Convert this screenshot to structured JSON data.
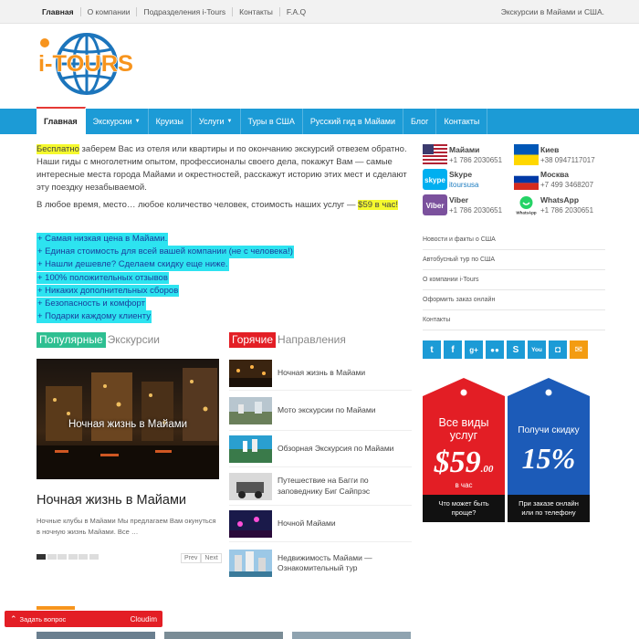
{
  "topbar": {
    "nav": [
      "Главная",
      "О компании",
      "Подразделения i-Tours",
      "Контакты",
      "F.A.Q"
    ],
    "tagline": "Экскурсии в Майами и США."
  },
  "logo": {
    "text": "i-TOURS",
    "brand_orange": "#f7941d",
    "brand_blue": "#1c75bc"
  },
  "mainnav": {
    "items": [
      {
        "label": "Главная",
        "active": true,
        "caret": false
      },
      {
        "label": "Экскурсии",
        "active": false,
        "caret": true
      },
      {
        "label": "Круизы",
        "active": false,
        "caret": false
      },
      {
        "label": "Услуги",
        "active": false,
        "caret": true
      },
      {
        "label": "Туры в США",
        "active": false,
        "caret": false
      },
      {
        "label": "Русский гид в Майами",
        "active": false,
        "caret": false
      },
      {
        "label": "Блог",
        "active": false,
        "caret": false
      },
      {
        "label": "Контакты",
        "active": false,
        "caret": false
      }
    ],
    "color": "#1c9bd6"
  },
  "intro": {
    "free": "Бесплатно",
    "p1": " заберем Вас из отеля или квартиры и по окончанию экскурсий отвезем обратно.",
    "p2": "Наши гиды с многолетним опытом, профессионалы своего дела, покажут Вам — самые интересные места города Майами и окрестностей, расскажут историю этих мест и сделают эту поездку незабываемой.",
    "p3": "В любое время, место… любое количество человек, стоимость наших услуг — ",
    "price": "$59 в час!"
  },
  "benefits": [
    "+ Самая низкая цена в Майами.",
    "+ Единая стоимость для всей вашей компании (не с человека!)",
    "+ Нашли дешевле? Сделаем скидку еще ниже.",
    "+ 100% положительных отзывов",
    "+ Никаких дополнительных сборов",
    "+ Безопасность и комфорт",
    "+ Подарки каждому клиенту"
  ],
  "popular": {
    "tag": "Популярные",
    "rest": "Экскурсии",
    "tag_color": "#2ebf91",
    "image_caption": "Ночная жизнь в Майами",
    "title": "Ночная жизнь в Майами",
    "desc": "Ночные клубы в Майами Мы предлагаем Вам окунуться в ночную жизнь Майами. Все …",
    "prev": "Prev",
    "next": "Next"
  },
  "hot": {
    "tag": "Горячие",
    "rest": "Направления",
    "tag_color": "#e31e25",
    "items": [
      "Ночная жизнь в Майами",
      "Мото экскурсии по Майами",
      "Обзорная Экскурсия по Майами",
      "Путешествие на Багги по заповеднику Биг Сайпрэс",
      "Ночной Майами",
      "Недвижимость Майами — Ознакомительный тур"
    ]
  },
  "contacts": [
    {
      "name": "Майами",
      "value": "+1 786 2030651",
      "icon": "us-flag-icon"
    },
    {
      "name": "Киев",
      "value": "+38 0947117017",
      "icon": "ua-flag-icon"
    },
    {
      "name": "Skype",
      "value": "itoursusa",
      "icon": "skype-icon"
    },
    {
      "name": "Москва",
      "value": "+7 499 3468207",
      "icon": "ru-flag-icon"
    },
    {
      "name": "Viber",
      "value": "+1 786 2030651",
      "icon": "viber-icon"
    },
    {
      "name": "WhatsApp",
      "value": "+1 786 2030651",
      "icon": "whatsapp-icon"
    }
  ],
  "sidebar_links": [
    "Новости и факты о США",
    "Автобусный тур по США",
    "О компании i-Tours",
    "Оформить заказ онлайн",
    "Контакты"
  ],
  "social": [
    "twitter-icon",
    "facebook-icon",
    "google-plus-icon",
    "flickr-icon",
    "skype-icon",
    "youtube-icon",
    "instagram-icon",
    "email-icon"
  ],
  "promo_red": {
    "line1": "Все виды",
    "line2": "услуг",
    "price": "$59",
    "cents": ".00",
    "per": "в час",
    "q": "Что может быть проще?",
    "color": "#e31e25"
  },
  "promo_blue": {
    "line1": "Получи скидку",
    "pct": "15%",
    "note": "При заказе онлайн или по телефону",
    "color": "#1c5bb8"
  },
  "ask": {
    "label": "Задать вопрос",
    "brand": "Cloudim"
  }
}
